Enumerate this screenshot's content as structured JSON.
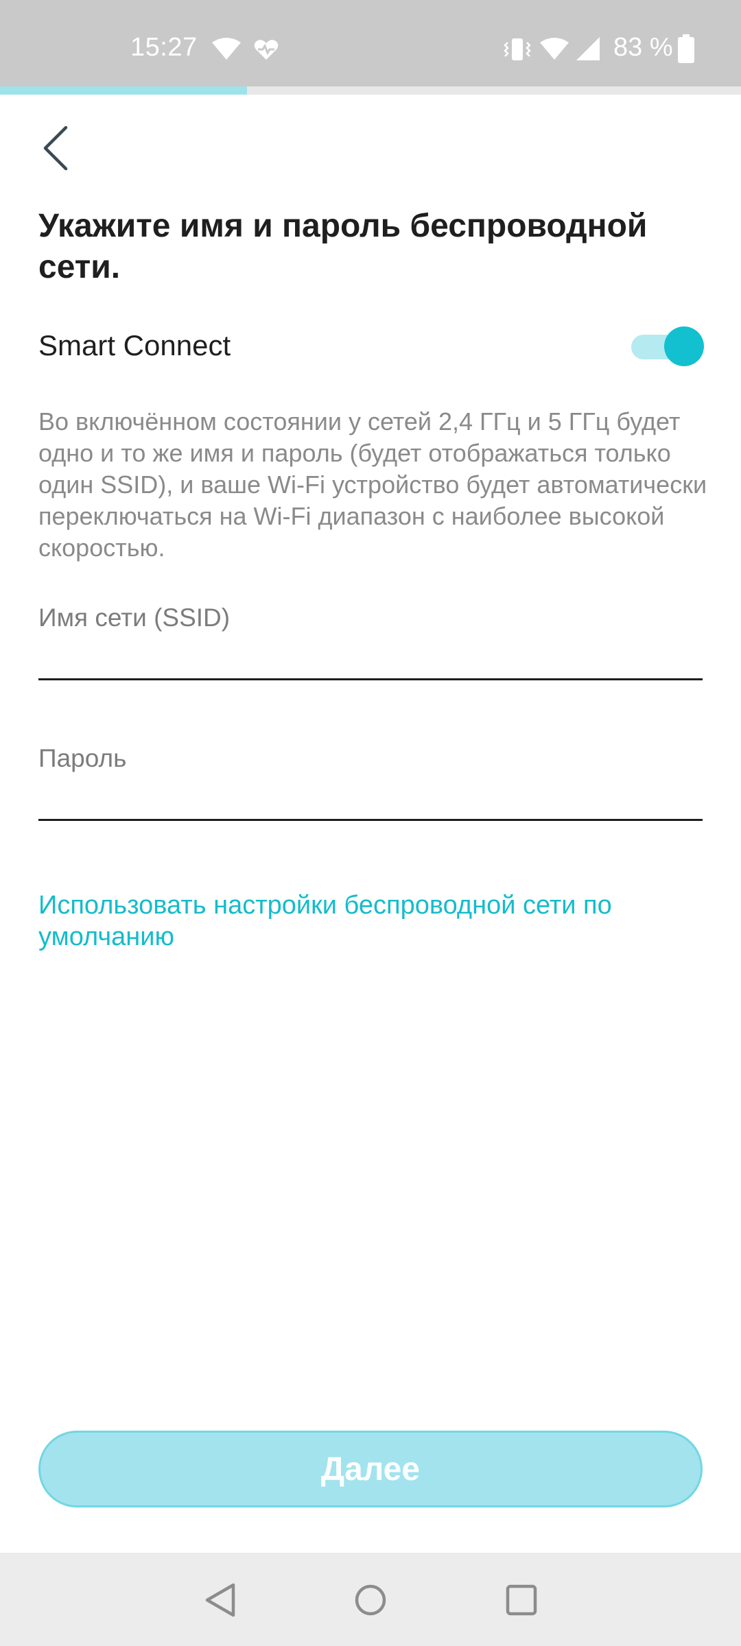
{
  "status_bar": {
    "time": "15:27",
    "battery_percent": "83 %",
    "icons": [
      "wifi-icon",
      "heart-monitor-icon",
      "vibrate-icon",
      "wifi-icon",
      "cell-signal-icon",
      "battery-icon"
    ]
  },
  "progress": {
    "fraction": 0.333
  },
  "header": {
    "back_icon": "chevron-left-icon"
  },
  "page": {
    "title": "Укажите имя и пароль беспроводной сети.",
    "smart_connect": {
      "label": "Smart Connect",
      "enabled": true
    },
    "description": "Во включённом состоянии у сетей 2,4 ГГц и 5 ГГц будет одно и то же имя и пароль (будет отображаться только один SSID), и ваше Wi-Fi устройство будет автоматически переключаться на Wi-Fi диапазон с наиболее высокой скоростью.",
    "ssid_field": {
      "label": "Имя сети (SSID)",
      "value": ""
    },
    "password_field": {
      "label": "Пароль",
      "value": ""
    },
    "default_settings_link": "Использовать настройки беспроводной сети по умолчанию",
    "next_button": "Далее"
  },
  "colors": {
    "accent": "#12c0cf",
    "toggle_track": "#b4eaf0",
    "button_disabled": "#a2e3ee",
    "status_bar": "#c9c9c9",
    "nav_bar": "#ececec"
  },
  "nav_bar": {
    "icons": [
      "back-triangle-icon",
      "home-circle-icon",
      "recents-square-icon"
    ]
  }
}
